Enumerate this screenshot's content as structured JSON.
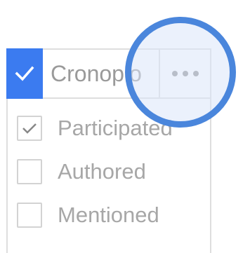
{
  "header": {
    "label": "Cronopio",
    "checked": true,
    "more_icon": "more-horizontal-icon"
  },
  "options": [
    {
      "label": "Participated",
      "checked": true
    },
    {
      "label": "Authored",
      "checked": false
    },
    {
      "label": "Mentioned",
      "checked": false
    }
  ],
  "colors": {
    "accent": "#3b7bf0",
    "highlight_ring": "#4a86dc",
    "border": "#dedede",
    "muted_text": "#9a9a9a"
  }
}
